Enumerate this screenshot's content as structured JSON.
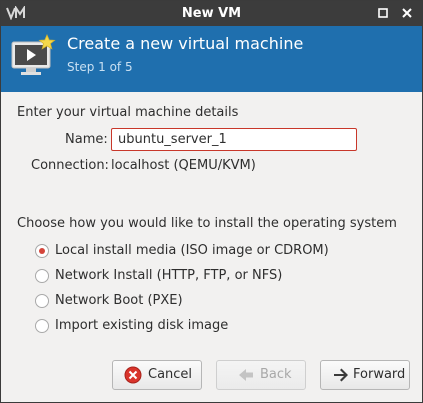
{
  "window": {
    "title": "New VM"
  },
  "header": {
    "title": "Create a new virtual machine",
    "step": "Step 1 of 5"
  },
  "details": {
    "heading": "Enter your virtual machine details",
    "name_label": "Name:",
    "name_value": "ubuntu_server_1",
    "connection_label": "Connection:",
    "connection_value": "localhost (QEMU/KVM)"
  },
  "install": {
    "heading": "Choose how you would like to install the operating system",
    "options": [
      {
        "label": "Local install media (ISO image or CDROM)",
        "checked": true
      },
      {
        "label": "Network Install (HTTP, FTP, or NFS)",
        "checked": false
      },
      {
        "label": "Network Boot (PXE)",
        "checked": false
      },
      {
        "label": "Import existing disk image",
        "checked": false
      }
    ]
  },
  "buttons": {
    "cancel": "Cancel",
    "back": "Back",
    "forward": "Forward"
  },
  "colors": {
    "titlebar": "#3c3c3c",
    "header": "#1f6fae",
    "radio_selected": "#d4453a",
    "input_border": "#c8372a"
  },
  "icons": {
    "app": "virt-manager-logo-icon",
    "header": "new-vm-monitor-icon",
    "cancel": "cancel-icon",
    "back": "back-arrow-icon",
    "forward": "forward-arrow-icon"
  }
}
